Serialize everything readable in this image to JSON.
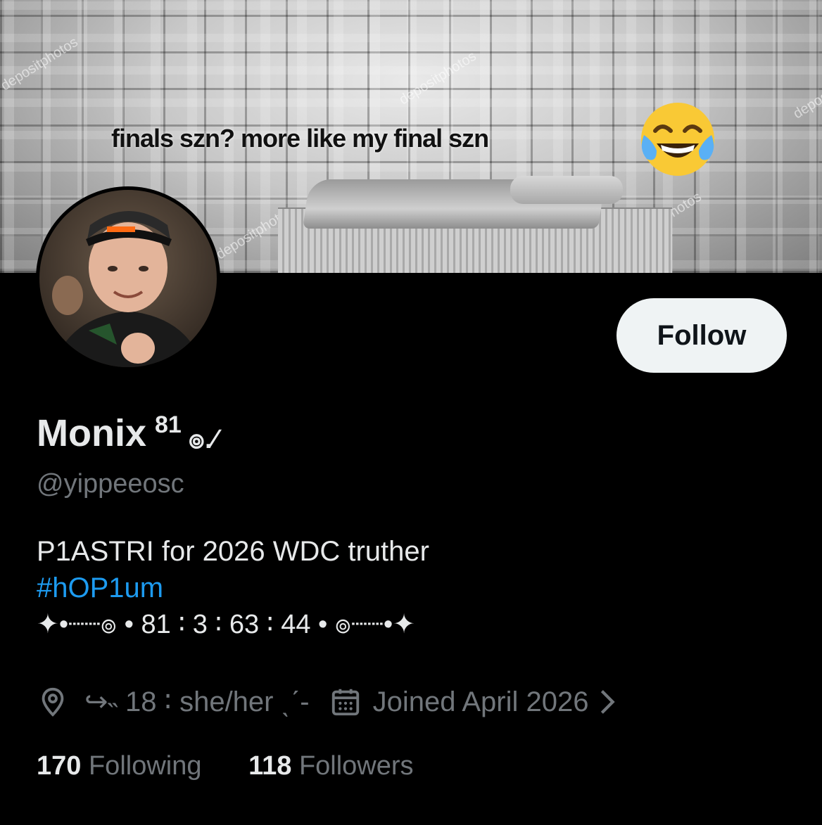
{
  "banner": {
    "caption": "finals szn? more like my final szn",
    "watermark": "depositphotos",
    "emoji": "face-with-tears-of-joy"
  },
  "profile": {
    "display_name": "Monix",
    "name_superscript": "81",
    "name_decoration": "๏.⁄",
    "handle": "@yippeeosc",
    "follow_label": "Follow"
  },
  "bio": {
    "line1": "P1ASTRI for 2026 WDC truther",
    "hashtag": "#hOP1um",
    "line3": "✦•┈┈๏ • 81 ∶ 3 ∶ 63 ∶ 44 • ๏┈┈•✦"
  },
  "meta": {
    "location": "↪˵  18 ∶ she/her ˎˊ-",
    "joined": "Joined April 2026"
  },
  "stats": {
    "following_count": "170",
    "following_label": "Following",
    "followers_count": "118",
    "followers_label": "Followers"
  },
  "colors": {
    "background": "#000000",
    "text": "#e7e9ea",
    "muted": "#71767b",
    "link": "#1d9bf0",
    "button": "#eff3f4"
  }
}
